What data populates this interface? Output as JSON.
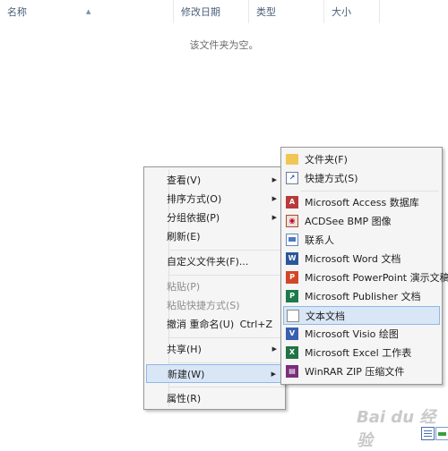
{
  "columns": {
    "name": "名称",
    "modified": "修改日期",
    "type": "类型",
    "size": "大小"
  },
  "empty_message": "该文件夹为空。",
  "context_menu": {
    "view": "查看(V)",
    "sort_by": "排序方式(O)",
    "group_by": "分组依据(P)",
    "refresh": "刷新(E)",
    "customize_folder": "自定义文件夹(F)...",
    "paste": "粘贴(P)",
    "paste_shortcut": "粘贴快捷方式(S)",
    "undo_rename": "撤消 重命名(U)",
    "undo_rename_shortcut": "Ctrl+Z",
    "share": "共享(H)",
    "new": "新建(W)",
    "properties": "属性(R)"
  },
  "new_submenu": [
    {
      "label": "文件夹(F)",
      "icon": "folder-icon"
    },
    {
      "label": "快捷方式(S)",
      "icon": "shortcut-icon"
    },
    {
      "label": "Microsoft Access 数据库",
      "icon": "access-icon"
    },
    {
      "label": "ACDSee BMP 图像",
      "icon": "bmp-image-icon"
    },
    {
      "label": "联系人",
      "icon": "contact-icon"
    },
    {
      "label": "Microsoft Word 文档",
      "icon": "word-icon"
    },
    {
      "label": "Microsoft PowerPoint 演示文稿",
      "icon": "powerpoint-icon"
    },
    {
      "label": "Microsoft Publisher 文档",
      "icon": "publisher-icon"
    },
    {
      "label": "文本文档",
      "icon": "text-document-icon"
    },
    {
      "label": "Microsoft Visio 绘图",
      "icon": "visio-icon"
    },
    {
      "label": "Microsoft Excel 工作表",
      "icon": "excel-icon"
    },
    {
      "label": "WinRAR ZIP 压缩文件",
      "icon": "winrar-icon"
    }
  ],
  "watermark": "Bai du 经验"
}
